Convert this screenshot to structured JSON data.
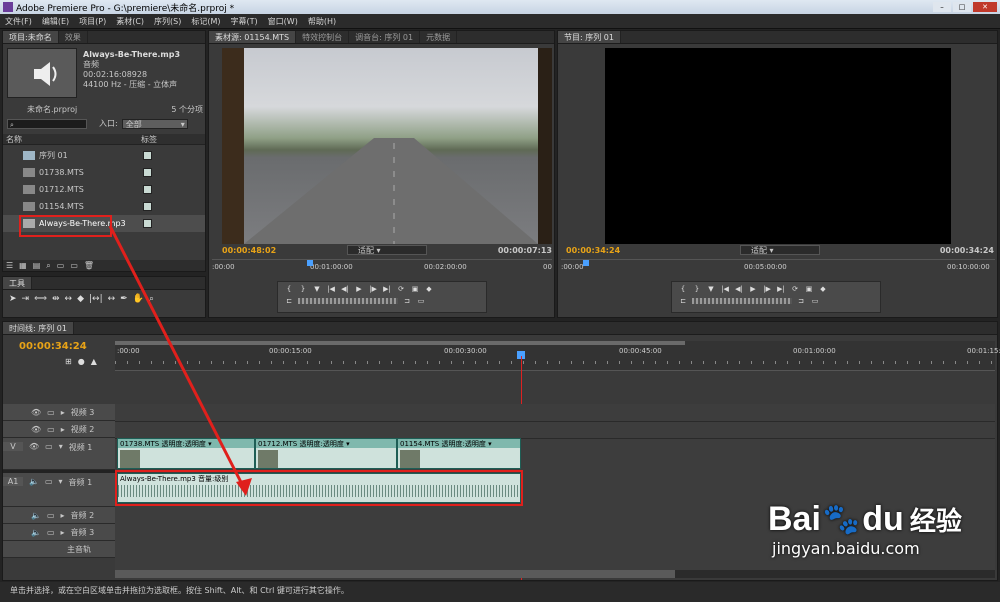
{
  "window": {
    "title": "Adobe Premiere Pro - G:\\premiere\\未命名.prproj *",
    "controls": [
      "–",
      "□",
      "✕"
    ]
  },
  "menu": [
    "文件(F)",
    "编辑(E)",
    "项目(P)",
    "素材(C)",
    "序列(S)",
    "标记(M)",
    "字幕(T)",
    "窗口(W)",
    "帮助(H)"
  ],
  "project": {
    "tabs": [
      "项目:未命名",
      "效果"
    ],
    "preview": {
      "name": "Always-Be-There.mp3",
      "type": "音频",
      "duration": "00:02:16:08928",
      "info": "44100 Hz - 压缩 - 立体声"
    },
    "file": "未命名.prproj",
    "count": "5 个分项",
    "in_label": "入口:",
    "in_value": "全部",
    "col_name": "名称",
    "col_label": "标签",
    "items": [
      {
        "name": "序列 01",
        "color": "#c9dad3"
      },
      {
        "name": "01738.MTS",
        "color": "#c9dad3"
      },
      {
        "name": "01712.MTS",
        "color": "#c9dad3"
      },
      {
        "name": "01154.MTS",
        "color": "#c9dad3"
      },
      {
        "name": "Always-Be-There.mp3",
        "color": "#c9dad3"
      }
    ]
  },
  "source": {
    "tabs": [
      "素材源: 01154.MTS",
      "特效控制台",
      "调音台: 序列 01",
      "元数据"
    ],
    "timecode": "00:00:48:02",
    "fit": "适配",
    "duration": "00:00:07:13",
    "ruler": [
      ":00:00",
      "00:01:00:00",
      "00:02:00:00",
      "00"
    ]
  },
  "program": {
    "tabs": [
      "节目: 序列 01"
    ],
    "timecode": "00:00:34:24",
    "fit": "适配",
    "duration": "00:00:34:24",
    "ruler": [
      ":00:00",
      "00:05:00:00",
      "00:10:00:00"
    ]
  },
  "tools": {
    "title": "工具"
  },
  "timeline": {
    "tabs": [
      "时间线: 序列 01"
    ],
    "timecode": "00:00:34:24",
    "ruler": [
      ":00:00",
      "00:00:15:00",
      "00:00:30:00",
      "00:00:45:00",
      "00:01:00:00",
      "00:01:15:00"
    ],
    "tracks": {
      "v3": "视频 3",
      "v2": "视频 2",
      "v1": "视频 1",
      "v_label": "V",
      "a1": "音频 1",
      "a2": "音频 2",
      "a3": "音频 3",
      "master": "主音轨",
      "a_label": "A1"
    },
    "clips": [
      {
        "name": "01738.MTS",
        "fx": "透明度:透明度"
      },
      {
        "name": "01712.MTS",
        "fx": "透明度:透明度"
      },
      {
        "name": "01154.MTS",
        "fx": "透明度:透明度"
      }
    ],
    "audio_clip": "Always-Be-There.mp3 音量:级别"
  },
  "status": "单击并选择，或在空白区域单击并拖拉为选取框。按住 Shift、Alt、和 Ctrl 键可进行其它操作。",
  "watermark": {
    "brand": "Bai",
    "suffix": "du",
    "cn": "经验",
    "url": "jingyan.baidu.com"
  }
}
